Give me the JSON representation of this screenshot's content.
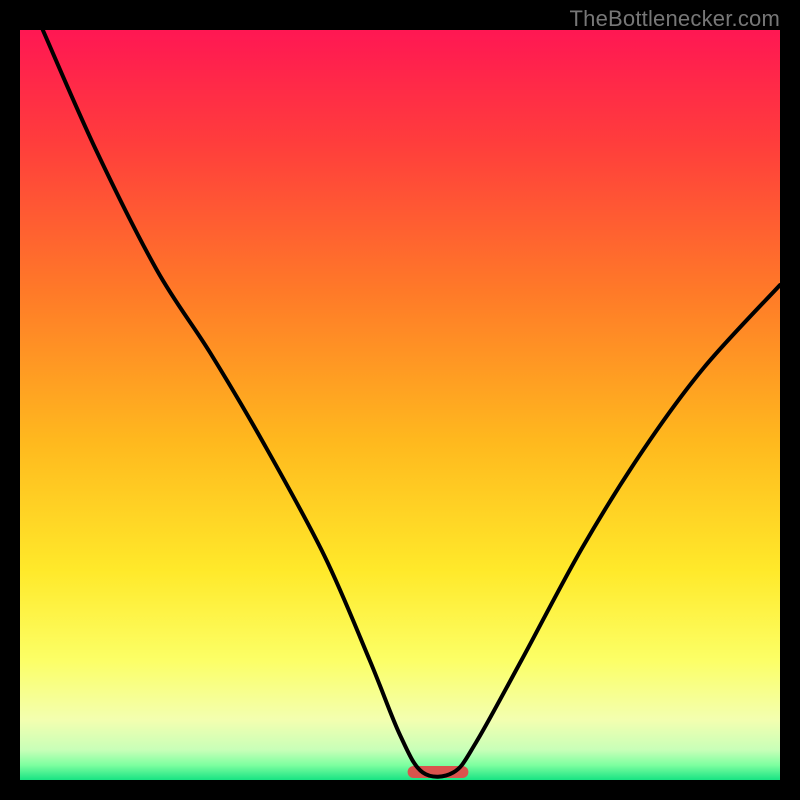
{
  "watermark": "TheBottlenecker.com",
  "chart_data": {
    "type": "line",
    "title": "",
    "xlabel": "",
    "ylabel": "",
    "x_range": [
      0,
      100
    ],
    "y_range": [
      0,
      100
    ],
    "optimal_zone": {
      "x_start": 51,
      "x_end": 59,
      "color": "#d9544d"
    },
    "gradient_stops": [
      {
        "offset": 0,
        "color": "#ff1753"
      },
      {
        "offset": 15,
        "color": "#ff3d3c"
      },
      {
        "offset": 35,
        "color": "#ff7a28"
      },
      {
        "offset": 55,
        "color": "#ffb91e"
      },
      {
        "offset": 72,
        "color": "#ffe92a"
      },
      {
        "offset": 84,
        "color": "#fcff66"
      },
      {
        "offset": 92,
        "color": "#f3ffb0"
      },
      {
        "offset": 96,
        "color": "#c8ffb8"
      },
      {
        "offset": 98,
        "color": "#7effa0"
      },
      {
        "offset": 100,
        "color": "#18e383"
      }
    ],
    "series": [
      {
        "name": "bottleneck-curve",
        "points": [
          {
            "x": 3,
            "y": 100
          },
          {
            "x": 10,
            "y": 84
          },
          {
            "x": 18,
            "y": 68
          },
          {
            "x": 25,
            "y": 57
          },
          {
            "x": 32,
            "y": 45
          },
          {
            "x": 40,
            "y": 30
          },
          {
            "x": 46,
            "y": 16
          },
          {
            "x": 50,
            "y": 6
          },
          {
            "x": 53,
            "y": 1
          },
          {
            "x": 57,
            "y": 1
          },
          {
            "x": 60,
            "y": 5
          },
          {
            "x": 66,
            "y": 16
          },
          {
            "x": 74,
            "y": 31
          },
          {
            "x": 82,
            "y": 44
          },
          {
            "x": 90,
            "y": 55
          },
          {
            "x": 100,
            "y": 66
          }
        ]
      }
    ]
  }
}
